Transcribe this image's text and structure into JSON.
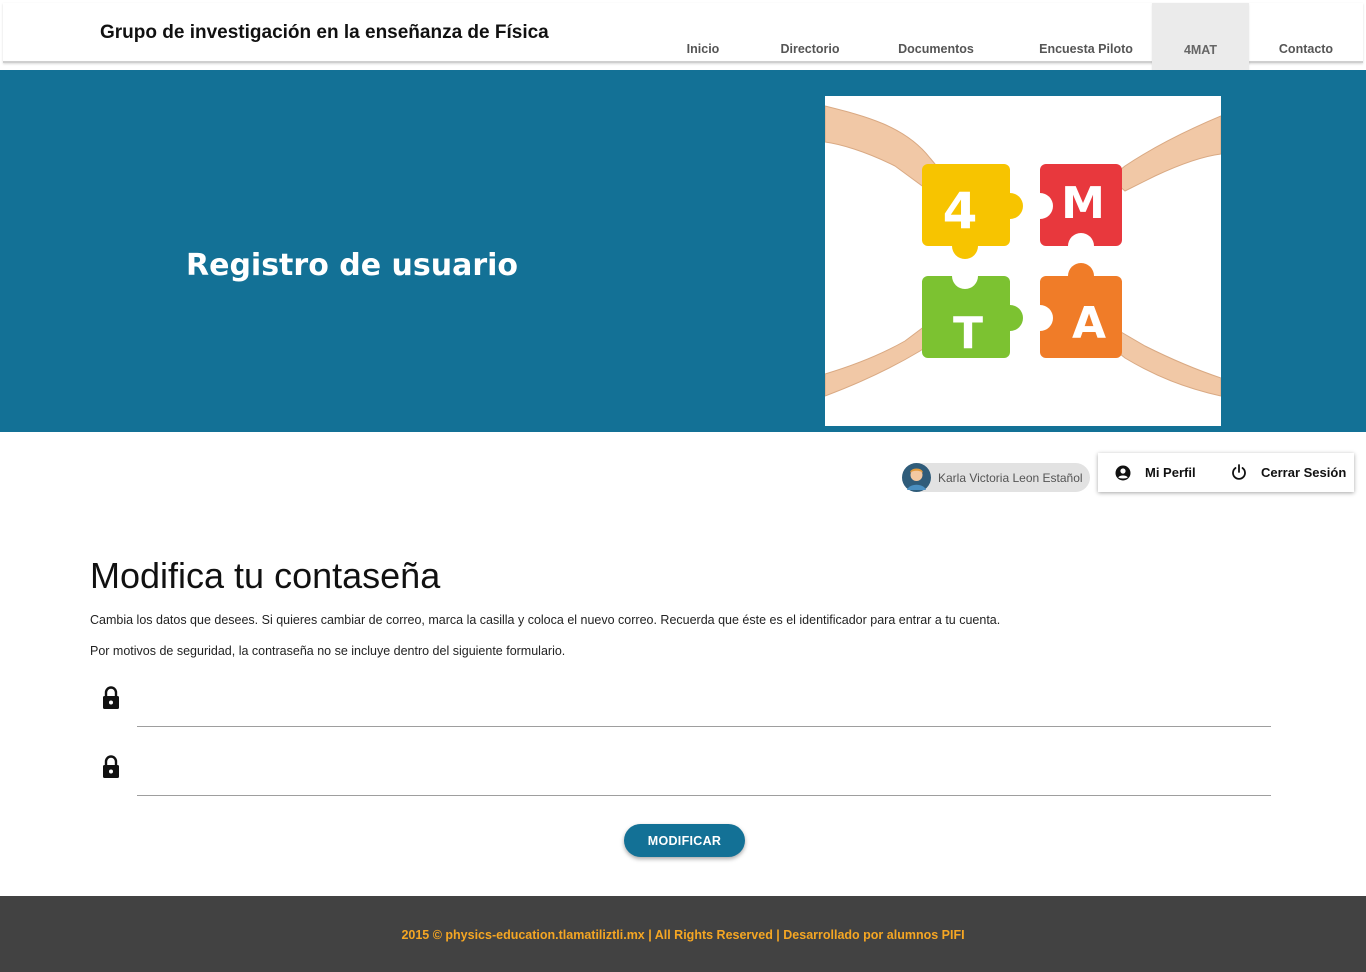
{
  "header": {
    "site_title": "Grupo de investigación en la enseñanza de Física",
    "nav": [
      "Inicio",
      "Directorio",
      "Documentos",
      "Encuesta Piloto",
      "4MAT",
      "Contacto"
    ],
    "active_nav": "4MAT"
  },
  "hero": {
    "title": "Registro de usuario",
    "image_letters": [
      "4",
      "M",
      "T",
      "A"
    ]
  },
  "user": {
    "name": "Karla Victoria Leon Estañol",
    "profile_label": "Mi Perfil",
    "logout_label": "Cerrar Sesión"
  },
  "main": {
    "heading": "Modifica tu contaseña",
    "paragraph1": "Cambia los datos que desees. Si quieres cambiar de correo, marca la casilla y coloca el nuevo correo. Recuerda que éste es el identificador para entrar a tu cuenta.",
    "paragraph2": "Por motivos de seguridad, la contraseña no se incluye dentro del siguiente formulario.",
    "fields": [
      {
        "value": "",
        "icon": "lock-icon"
      },
      {
        "value": "",
        "icon": "lock-icon"
      }
    ],
    "submit_label": "MODIFICAR"
  },
  "footer": {
    "text": "2015 © physics-education.tlamatiliztli.mx | All Rights Reserved | Desarrollado por alumnos PIFI"
  },
  "colors": {
    "primary": "#137196",
    "footer_bg": "#424242",
    "footer_text": "#f5a623",
    "puzzle_yellow": "#f7c400",
    "puzzle_red": "#e8383d",
    "puzzle_green": "#7cc231",
    "puzzle_orange": "#f07c28"
  }
}
